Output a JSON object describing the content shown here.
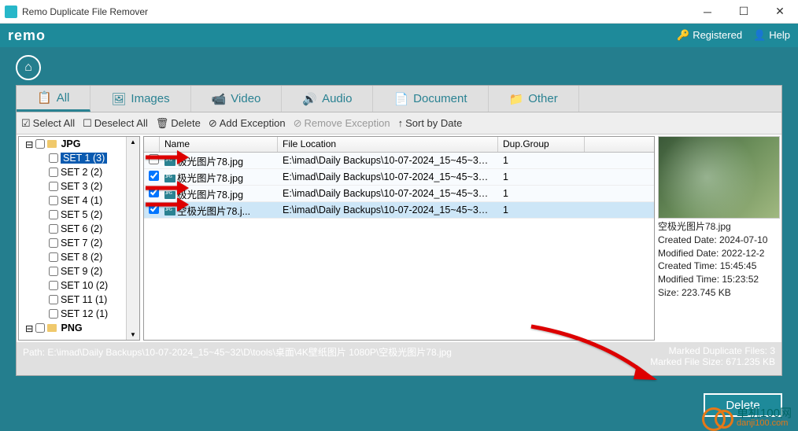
{
  "window": {
    "title": "Remo Duplicate File Remover"
  },
  "topbar": {
    "logo": "remo",
    "registered": "Registered",
    "help": "Help"
  },
  "tabs": [
    {
      "icon": "list-icon",
      "label": "All",
      "active": true
    },
    {
      "icon": "image-icon",
      "label": "Images"
    },
    {
      "icon": "video-icon",
      "label": "Video"
    },
    {
      "icon": "audio-icon",
      "label": "Audio"
    },
    {
      "icon": "document-icon",
      "label": "Document"
    },
    {
      "icon": "other-icon",
      "label": "Other"
    }
  ],
  "toolbar": {
    "select_all": "Select All",
    "deselect_all": "Deselect All",
    "delete": "Delete",
    "add_exception": "Add Exception",
    "remove_exception": "Remove Exception",
    "sort": "Sort by Date"
  },
  "tree": {
    "root": "JPG",
    "items": [
      {
        "label": "SET 1 (3)",
        "selected": true
      },
      {
        "label": "SET 2 (2)"
      },
      {
        "label": "SET 3 (2)"
      },
      {
        "label": "SET 4 (1)"
      },
      {
        "label": "SET 5 (2)"
      },
      {
        "label": "SET 6 (2)"
      },
      {
        "label": "SET 7 (2)"
      },
      {
        "label": "SET 8 (2)"
      },
      {
        "label": "SET 9 (2)"
      },
      {
        "label": "SET 10 (2)"
      },
      {
        "label": "SET 11 (1)"
      },
      {
        "label": "SET 12 (1)"
      }
    ],
    "next": "PNG"
  },
  "grid": {
    "columns": {
      "name": "Name",
      "loc": "File Location",
      "grp": "Dup.Group"
    },
    "rows": [
      {
        "checked": false,
        "name": "极光图片78.jpg",
        "loc": "E:\\imad\\Daily Backups\\10-07-2024_15~45~32\\...",
        "grp": "1"
      },
      {
        "checked": true,
        "name": "极光图片78.jpg",
        "loc": "E:\\imad\\Daily Backups\\10-07-2024_15~45~32\\...",
        "grp": "1"
      },
      {
        "checked": true,
        "name": "极光图片78.jpg",
        "loc": "E:\\imad\\Daily Backups\\10-07-2024_15~45~32\\...",
        "grp": "1"
      },
      {
        "checked": true,
        "name": "空极光图片78.j...",
        "loc": "E:\\imad\\Daily Backups\\10-07-2024_15~45~32\\...",
        "grp": "1",
        "sel": true
      }
    ]
  },
  "preview": {
    "filename": "空极光图片78.jpg",
    "created_date": "Created Date: 2024-07-10",
    "modified_date": "Modified Date: 2022-12-2",
    "created_time": "Created Time: 15:45:45",
    "modified_time": "Modified Time: 15:23:52",
    "size": "Size: 223.745 KB"
  },
  "status": {
    "path_label": "Path:",
    "path": "E:\\imad\\Daily Backups\\10-07-2024_15~45~32\\D\\tools\\桌面\\4K壁纸图片 1080P\\空极光图片78.jpg",
    "marked_files": "Marked Duplicate Files: 3",
    "marked_size": "Marked File Size: 671.235 KB"
  },
  "delete_btn": "Delete",
  "watermark": {
    "cn": "单机100网",
    "dm": "danji100.com"
  }
}
